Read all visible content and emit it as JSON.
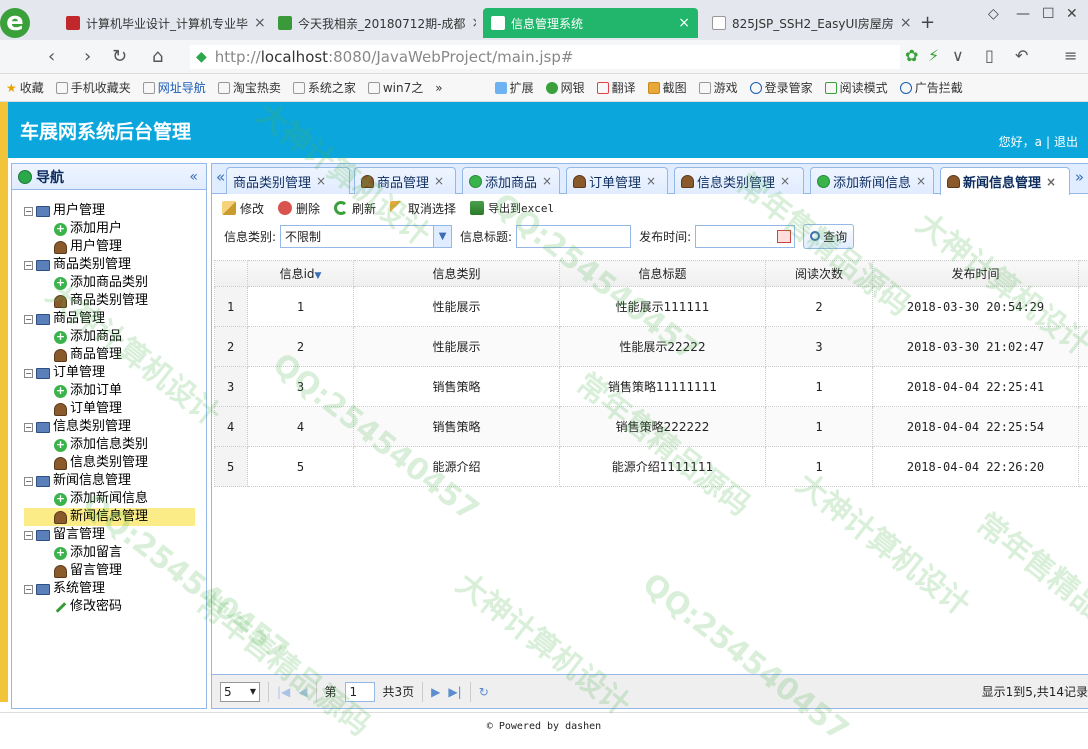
{
  "browser": {
    "tabs": [
      {
        "title": "计算机毕业设计_计算机专业毕",
        "active": false
      },
      {
        "title": "今天我相亲_20180712期-成都",
        "active": false
      },
      {
        "title": "信息管理系统",
        "active": true
      },
      {
        "title": "825JSP_SSH2_EasyUI房屋房",
        "active": false
      }
    ],
    "url_scheme": "http://",
    "url_host": "localhost",
    "url_path": ":8080/JavaWebProject/main.jsp#",
    "bookmarks": [
      "收藏",
      "手机收藏夹",
      "网址导航",
      "淘宝热卖",
      "系统之家",
      "win7之",
      "»",
      "扩展",
      "网银",
      "翻译",
      "截图",
      "游戏",
      "登录管家",
      "阅读模式",
      "广告拦截"
    ]
  },
  "app": {
    "title": "车展网系统后台管理",
    "greeting": "您好，",
    "username": "a",
    "separator": "|",
    "logout": "退出"
  },
  "nav": {
    "title": "导航",
    "collapse": "«",
    "groups": [
      {
        "label": "用户管理",
        "children": [
          {
            "label": "添加用户",
            "icon": "add-icon"
          },
          {
            "label": "用户管理",
            "icon": "user-icon"
          }
        ]
      },
      {
        "label": "商品类别管理",
        "children": [
          {
            "label": "添加商品类别",
            "icon": "add-icon"
          },
          {
            "label": "商品类别管理",
            "icon": "user-icon"
          }
        ]
      },
      {
        "label": "商品管理",
        "children": [
          {
            "label": "添加商品",
            "icon": "add-icon"
          },
          {
            "label": "商品管理",
            "icon": "user-icon"
          }
        ]
      },
      {
        "label": "订单管理",
        "children": [
          {
            "label": "添加订单",
            "icon": "add-icon"
          },
          {
            "label": "订单管理",
            "icon": "user-icon"
          }
        ]
      },
      {
        "label": "信息类别管理",
        "children": [
          {
            "label": "添加信息类别",
            "icon": "add-icon"
          },
          {
            "label": "信息类别管理",
            "icon": "user-icon"
          }
        ]
      },
      {
        "label": "新闻信息管理",
        "children": [
          {
            "label": "添加新闻信息",
            "icon": "add-icon"
          },
          {
            "label": "新闻信息管理",
            "icon": "user-icon",
            "selected": true
          }
        ]
      },
      {
        "label": "留言管理",
        "children": [
          {
            "label": "添加留言",
            "icon": "add-icon"
          },
          {
            "label": "留言管理",
            "icon": "user-icon"
          }
        ]
      },
      {
        "label": "系统管理",
        "children": [
          {
            "label": "修改密码",
            "icon": "pencil-icon"
          }
        ]
      }
    ]
  },
  "tabs": [
    {
      "label": "商品类别管理",
      "icon": "none"
    },
    {
      "label": "商品管理",
      "icon": "user-icon"
    },
    {
      "label": "添加商品",
      "icon": "add-icon"
    },
    {
      "label": "订单管理",
      "icon": "user-icon"
    },
    {
      "label": "信息类别管理",
      "icon": "user-icon"
    },
    {
      "label": "添加新闻信息",
      "icon": "add-icon"
    },
    {
      "label": "新闻信息管理",
      "icon": "user-icon",
      "active": true
    }
  ],
  "tab_close": "×",
  "toolbar": {
    "edit": "修改",
    "delete": "删除",
    "refresh": "刷新",
    "cancel_select": "取消选择",
    "export": "导出到excel"
  },
  "search": {
    "category_label": "信息类别:",
    "category_value": "不限制",
    "title_label": "信息标题:",
    "title_value": "",
    "date_label": "发布时间:",
    "date_value": "",
    "query_button": "查询"
  },
  "table": {
    "columns": [
      "信息id",
      "信息类别",
      "信息标题",
      "阅读次数",
      "发布时间"
    ],
    "rows": [
      {
        "rownum": "1",
        "id": "1",
        "category": "性能展示",
        "title": "性能展示111111",
        "reads": "2",
        "time": "2018-03-30 20:54:29"
      },
      {
        "rownum": "2",
        "id": "2",
        "category": "性能展示",
        "title": "性能展示22222",
        "reads": "3",
        "time": "2018-03-30 21:02:47"
      },
      {
        "rownum": "3",
        "id": "3",
        "category": "销售策略",
        "title": "销售策略11111111",
        "reads": "1",
        "time": "2018-04-04 22:25:41"
      },
      {
        "rownum": "4",
        "id": "4",
        "category": "销售策略",
        "title": "销售策略222222",
        "reads": "1",
        "time": "2018-04-04 22:25:54"
      },
      {
        "rownum": "5",
        "id": "5",
        "category": "能源介绍",
        "title": "能源介绍1111111",
        "reads": "1",
        "time": "2018-04-04 22:26:20"
      }
    ]
  },
  "pager": {
    "page_size": "5",
    "page_label_before": "第",
    "page_value": "1",
    "page_label_after": "共3页",
    "info": "显示1到5,共14记录"
  },
  "footer": "© Powered by dashen",
  "watermarks": [
    "大神计算机设计",
    "QQ:254540457",
    "常年售精品源码"
  ]
}
